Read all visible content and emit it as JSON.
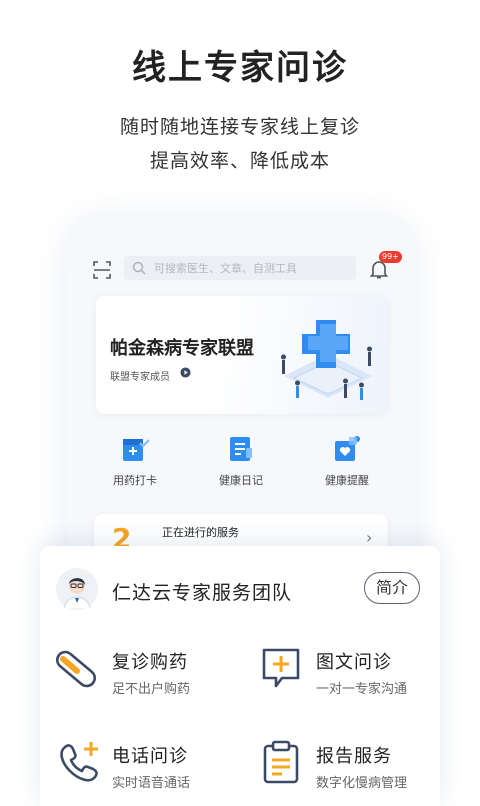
{
  "hero": {
    "title": "线上专家问诊",
    "subtitle_line1": "随时随地连接专家线上复诊",
    "subtitle_line2": "提高效率、降低成本"
  },
  "app": {
    "search_placeholder": "可搜索医生、文章、自测工具",
    "notification_badge": "99+",
    "banner": {
      "title": "帕金森病专家联盟",
      "link_text": "联盟专家成员"
    },
    "functions": [
      {
        "label": "用药打卡",
        "icon": "medicine-checkin-icon"
      },
      {
        "label": "健康日记",
        "icon": "health-diary-icon"
      },
      {
        "label": "健康提醒",
        "icon": "health-reminder-icon"
      }
    ],
    "service_card": {
      "count": "2",
      "title": "正在进行的服务"
    }
  },
  "team": {
    "name": "仁达云专家服务团队",
    "intro_button": "简介",
    "services": [
      {
        "title": "复诊购药",
        "desc": "足不出户购药",
        "icon": "pill-icon"
      },
      {
        "title": "图文问诊",
        "desc": "一对一专家沟通",
        "icon": "chat-plus-icon"
      },
      {
        "title": "电话问诊",
        "desc": "实时语音通话",
        "icon": "phone-plus-icon"
      },
      {
        "title": "报告服务",
        "desc": "数字化慢病管理",
        "icon": "clipboard-icon"
      }
    ]
  },
  "colors": {
    "accent_orange": "#f5a623",
    "icon_navy": "#3d4a66",
    "brand_blue": "#2f8cf0",
    "badge_red": "#ee3b2f"
  }
}
